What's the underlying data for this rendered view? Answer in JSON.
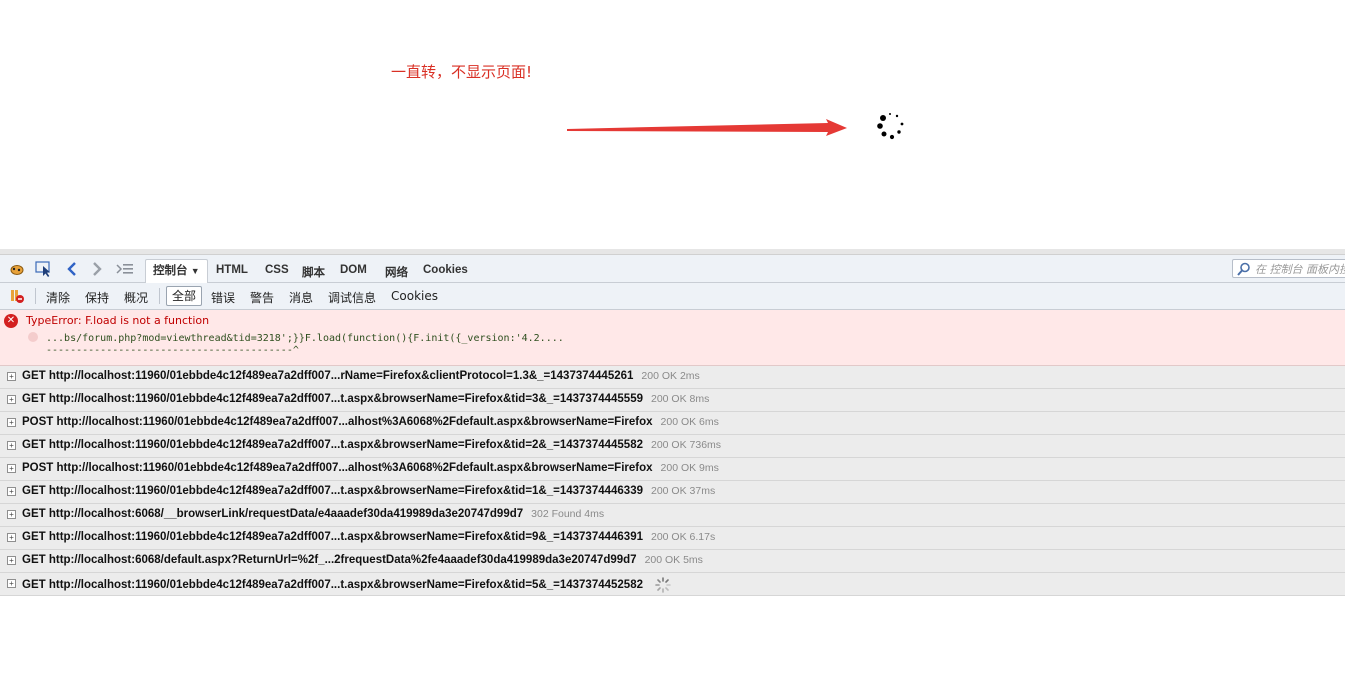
{
  "annotation": "一直转，不显示页面!",
  "colors": {
    "arrow": "#e53935",
    "error_bg": "#ffe8e8",
    "error_text": "#c00000"
  },
  "devtools": {
    "main_tabs": [
      {
        "label": "控制台",
        "active": true
      },
      {
        "label": "HTML"
      },
      {
        "label": "CSS"
      },
      {
        "label": "脚本"
      },
      {
        "label": "DOM"
      },
      {
        "label": "网络"
      },
      {
        "label": "Cookies"
      }
    ],
    "search_placeholder": "在 控制台 面板内搜",
    "console_toolbar": {
      "clear": "清除",
      "persist": "保持",
      "profile": "概况",
      "filters": [
        "全部",
        "错误",
        "警告",
        "消息",
        "调试信息",
        "Cookies"
      ]
    },
    "error": {
      "message": "TypeError: F.load is not a function",
      "source": "...bs/forum.php?mod=viewthread&tid=3218';}}F.load(function(){F.init({_version:'4.2....",
      "underline": "-----------------------------------------^"
    },
    "requests": [
      {
        "method": "GET",
        "url": "http://localhost:11960/01ebbde4c12f489ea7a2dff007...rName=Firefox&clientProtocol=1.3&_=1437374445261",
        "status": "200 OK 2ms"
      },
      {
        "method": "GET",
        "url": "http://localhost:11960/01ebbde4c12f489ea7a2dff007...t.aspx&browserName=Firefox&tid=3&_=1437374445559",
        "status": "200 OK 8ms"
      },
      {
        "method": "POST",
        "url": "http://localhost:11960/01ebbde4c12f489ea7a2dff007...alhost%3A6068%2Fdefault.aspx&browserName=Firefox",
        "status": "200 OK 6ms"
      },
      {
        "method": "GET",
        "url": "http://localhost:11960/01ebbde4c12f489ea7a2dff007...t.aspx&browserName=Firefox&tid=2&_=1437374445582",
        "status": "200 OK 736ms"
      },
      {
        "method": "POST",
        "url": "http://localhost:11960/01ebbde4c12f489ea7a2dff007...alhost%3A6068%2Fdefault.aspx&browserName=Firefox",
        "status": "200 OK 9ms"
      },
      {
        "method": "GET",
        "url": "http://localhost:11960/01ebbde4c12f489ea7a2dff007...t.aspx&browserName=Firefox&tid=1&_=1437374446339",
        "status": "200 OK 37ms"
      },
      {
        "method": "GET",
        "url": "http://localhost:6068/__browserLink/requestData/e4aaadef30da419989da3e20747d99d7",
        "status": "302 Found 4ms"
      },
      {
        "method": "GET",
        "url": "http://localhost:11960/01ebbde4c12f489ea7a2dff007...t.aspx&browserName=Firefox&tid=9&_=1437374446391",
        "status": "200 OK 6.17s"
      },
      {
        "method": "GET",
        "url": "http://localhost:6068/default.aspx?ReturnUrl=%2f_...2frequestData%2fe4aaadef30da419989da3e20747d99d7",
        "status": "200 OK 5ms"
      },
      {
        "method": "GET",
        "url": "http://localhost:11960/01ebbde4c12f489ea7a2dff007...t.aspx&browserName=Firefox&tid=5&_=1437374452582",
        "status": "",
        "pending": true
      }
    ]
  }
}
